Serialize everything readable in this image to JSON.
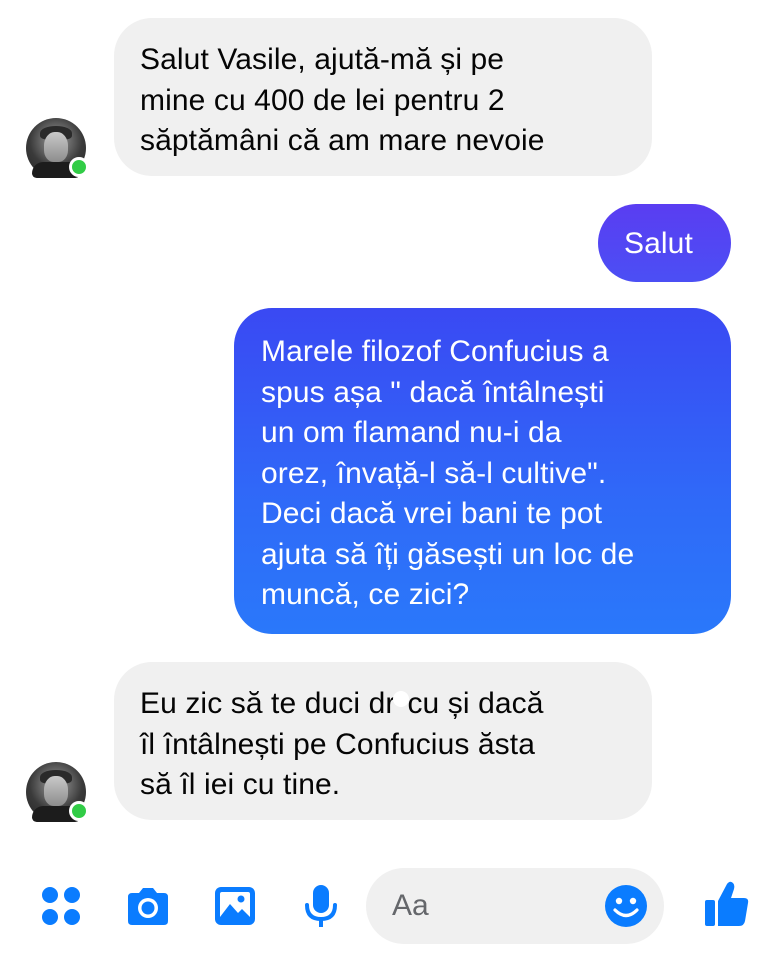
{
  "colors": {
    "accent": "#0a7cff",
    "incoming_bubble": "#f0f0f0",
    "outgoing_top": "#5a3df2",
    "outgoing_bottom": "#2a78fa",
    "online": "#31cc46"
  },
  "messages": [
    {
      "direction": "incoming",
      "lines": [
        "Salut Vasile, ajută-mă și pe",
        "mine cu 400 de lei pentru 2",
        "săptămâni că am mare nevoie"
      ]
    },
    {
      "direction": "outgoing",
      "lines": [
        "Salut"
      ]
    },
    {
      "direction": "outgoing",
      "lines": [
        "Marele filozof Confucius a",
        "spus așa \" dacă întâlnești",
        "un om flamand nu-i da",
        "orez, învață-l să-l cultive\".",
        "Deci dacă vrei bani te pot",
        "ajuta să îți găsești un loc de",
        "muncă, ce zici?"
      ]
    },
    {
      "direction": "incoming",
      "lines": [
        "Eu zic să te duci dr",
        "cu și dacă",
        "îl întâlnești pe Confucius ăsta",
        "să îl iei cu tine."
      ]
    }
  ],
  "composer": {
    "placeholder": "Aa"
  },
  "icons": {
    "apps": "apps-icon",
    "camera": "camera-icon",
    "gallery": "gallery-icon",
    "mic": "microphone-icon",
    "emoji": "emoji-icon",
    "like": "thumbs-up-icon"
  }
}
